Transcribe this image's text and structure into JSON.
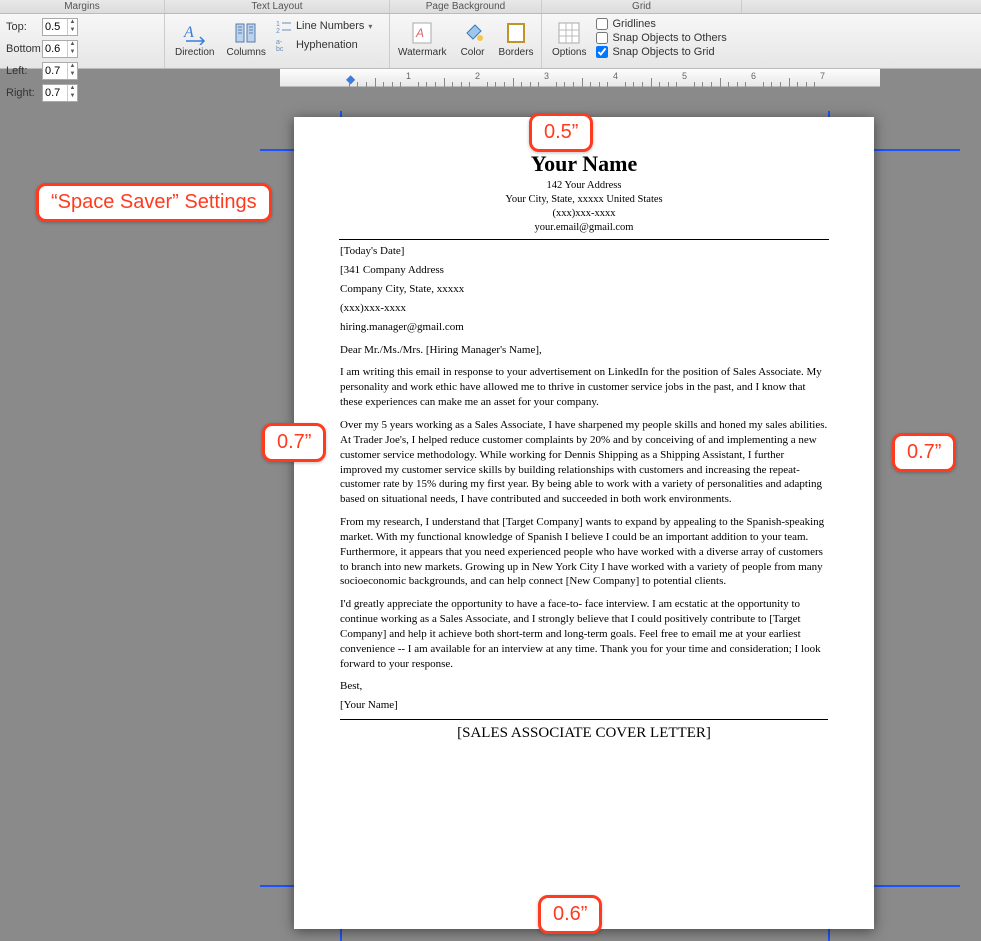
{
  "ribbon": {
    "groups": {
      "margins": "Margins",
      "textlayout": "Text Layout",
      "pagebg": "Page Background",
      "grid": "Grid"
    },
    "margins": {
      "top_label": "Top:",
      "top_value": "0.5",
      "bottom_label": "Bottom:",
      "bottom_value": "0.6",
      "left_label": "Left:",
      "left_value": "0.7",
      "right_label": "Right:",
      "right_value": "0.7"
    },
    "textlayout": {
      "direction": "Direction",
      "columns": "Columns",
      "linenumbers": "Line Numbers",
      "hyphenation": "Hyphenation"
    },
    "pagebg": {
      "watermark": "Watermark",
      "color": "Color",
      "borders": "Borders"
    },
    "grid": {
      "options": "Options",
      "gridlines": "Gridlines",
      "snap_others": "Snap Objects to Others",
      "snap_grid": "Snap Objects to Grid"
    }
  },
  "ruler": {
    "numbers": [
      "1",
      "2",
      "3",
      "4",
      "5",
      "6",
      "7"
    ]
  },
  "annotations": {
    "title": "“Space Saver” Settings",
    "top": "0.5”",
    "left": "0.7”",
    "right": "0.7”",
    "bottom": "0.6”"
  },
  "document": {
    "header": {
      "name": "Your Name",
      "addr1": "142 Your Address",
      "addr2": "Your City, State, xxxxx United States",
      "phone": "(xxx)xxx-xxxx",
      "email": "your.email@gmail.com"
    },
    "date": "[Today's Date]",
    "company_addr1": "[341 Company Address",
    "company_addr2": "Company City, State, xxxxx",
    "company_phone": "(xxx)xxx-xxxx",
    "company_email": "hiring.manager@gmail.com",
    "salutation": "Dear Mr./Ms./Mrs. [Hiring Manager's Name],",
    "p1": "I am writing this email in response to your advertisement on LinkedIn for the position of Sales Associate. My personality and work ethic have allowed me to thrive in customer service jobs in the past, and I know that these experiences can make me an asset for your company.",
    "p2": "Over my 5 years working as a Sales Associate, I have sharpened my people skills and honed my sales abilities. At Trader Joe's, I helped reduce customer complaints by 20% and by conceiving of and implementing a new customer service methodology. While working for Dennis Shipping as a Shipping Assistant, I further improved my customer service skills by building relationships with customers and increasing the repeat-customer rate by 15% during my first year. By being able to work with a variety of personalities and adapting based on situational needs, I have contributed and succeeded in both work environments.",
    "p3": "From my research, I understand that [Target Company] wants to expand by appealing to the Spanish-speaking market. With my functional knowledge of Spanish I believe I could be an important addition to your team. Furthermore, it appears that you need experienced people who have worked with a diverse array of customers to branch into new markets. Growing up in New York City I have worked with a variety of people from many socioeconomic backgrounds, and can help connect [New Company] to potential clients.",
    "p4": "I'd greatly appreciate the opportunity to have a face-to- face interview. I am ecstatic at the opportunity to continue working as a Sales Associate, and I strongly believe that I could positively contribute to [Target Company] and help it achieve both short-term and long-term goals. Feel free to email me at your earliest convenience -- I am available for an interview at any time. Thank you for your time and consideration; I look forward to your response.",
    "closing": "Best,",
    "sig": "[Your Name]",
    "footer_title": "[SALES ASSOCIATE COVER LETTER]"
  }
}
